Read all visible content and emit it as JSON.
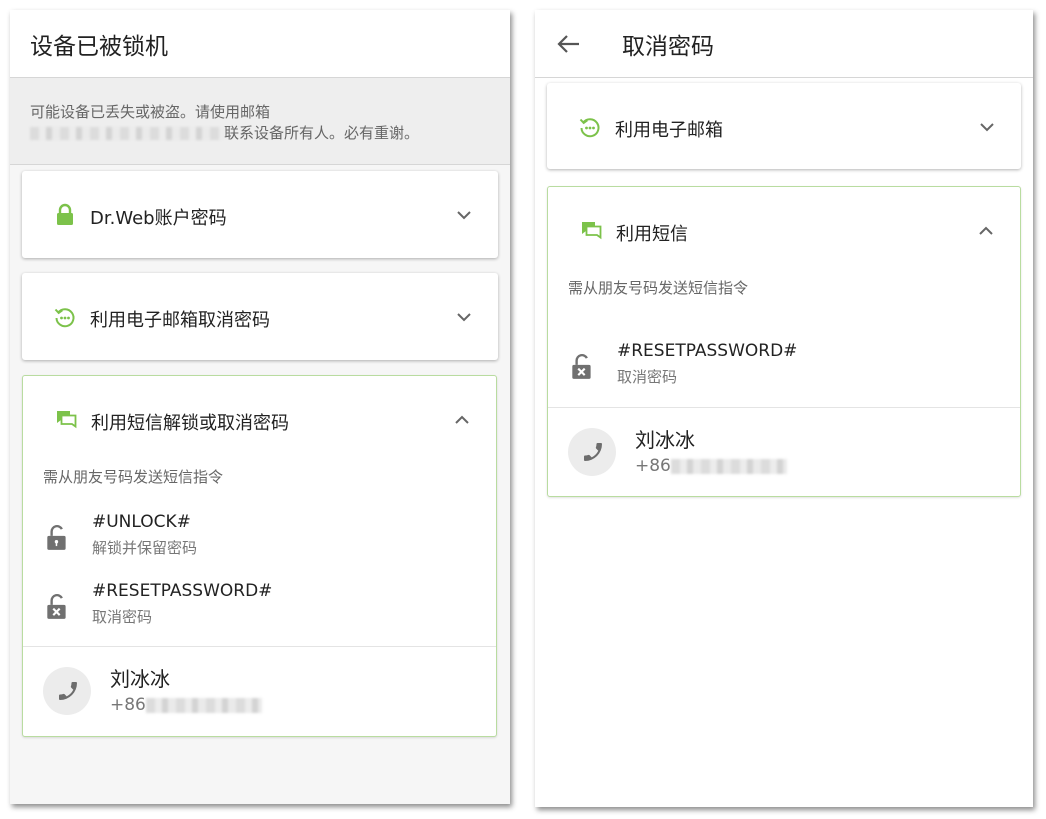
{
  "left": {
    "title": "设备已被锁机",
    "warning": {
      "line1": "可能设备已丢失或被盗。请使用邮箱",
      "line2_suffix": "联系设备所有人。必有重谢。"
    },
    "cards": {
      "account": {
        "title": "Dr.Web账户密码"
      },
      "email": {
        "title": "利用电子邮箱取消密码"
      },
      "sms": {
        "title": "利用短信解锁或取消密码",
        "hint": "需从朋友号码发送短信指令",
        "commands": [
          {
            "code": "#UNLOCK#",
            "desc": "解锁并保留密码"
          },
          {
            "code": "#RESETPASSWORD#",
            "desc": "取消密码"
          }
        ],
        "contact": {
          "name": "刘冰冰",
          "phone_prefix": "+86"
        }
      }
    }
  },
  "right": {
    "title": "取消密码",
    "cards": {
      "email": {
        "title": "利用电子邮箱"
      },
      "sms": {
        "title": "利用短信",
        "hint": "需从朋友号码发送短信指令",
        "commands": [
          {
            "code": "#RESETPASSWORD#",
            "desc": "取消密码"
          }
        ],
        "contact": {
          "name": "刘冰冰",
          "phone_prefix": "+86"
        }
      }
    }
  },
  "colors": {
    "accent_green": "#7cc24a",
    "card_border_green": "#b9dca0",
    "icon_gray": "#707070"
  },
  "icons": {
    "account": "lock-icon",
    "email": "restore-dots-icon",
    "sms": "chat-bubbles-icon",
    "unlock": "open-lock-icon",
    "reset": "lock-x-icon",
    "phone": "phone-icon",
    "back": "arrow-left-icon",
    "expand": "chevron-down-icon",
    "collapse": "chevron-up-icon"
  }
}
